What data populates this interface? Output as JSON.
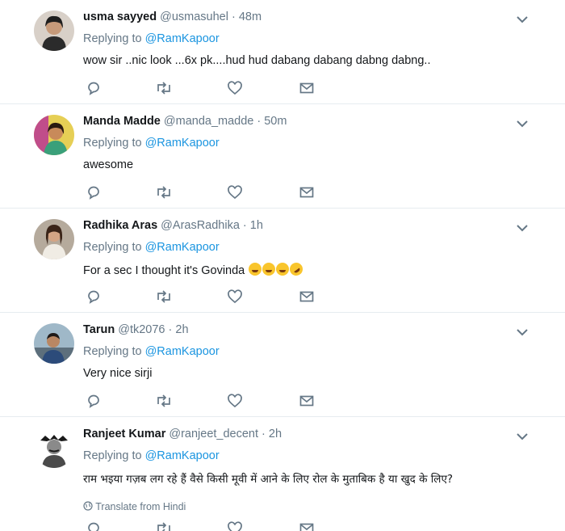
{
  "tweets": [
    {
      "name": "usma sayyed",
      "handle": "@usmasuhel · 48m",
      "replying_prefix": "Replying to ",
      "replying_to": "@RamKapoor",
      "text": "wow sir ..nic look ...6x pk....hud hud dabang dabang dabng dabng..",
      "avatar_color": "#2b2b2b"
    },
    {
      "name": "Manda Madde",
      "handle": "@manda_madde · 50m",
      "replying_prefix": "Replying to ",
      "replying_to": "@RamKapoor",
      "text": "awesome",
      "avatar_color": "#c9a63a"
    },
    {
      "name": "Radhika Aras",
      "handle": "@ArasRadhika · 1h",
      "replying_prefix": "Replying to ",
      "replying_to": "@RamKapoor",
      "text": "For a sec I thought it's Govinda",
      "emojis": [
        "face-with-tears-of-joy",
        "face-with-tears-of-joy",
        "face-with-tears-of-joy",
        "rolling-on-floor-laughing"
      ],
      "avatar_color": "#8a7a6a"
    },
    {
      "name": "Tarun",
      "handle": "@tk2076 · 2h",
      "replying_prefix": "Replying to ",
      "replying_to": "@RamKapoor",
      "text": "Very nice sirji",
      "avatar_color": "#4a6a8a"
    },
    {
      "name": "Ranjeet Kumar",
      "handle": "@ranjeet_decent · 2h",
      "replying_prefix": "Replying to ",
      "replying_to": "@RamKapoor",
      "text": "राम भइया गज़ब लग रहे हैं वैसे किसी मूवी में आने के लिए रोल के मुताबिक है या खुद के लिए?",
      "translate": "Translate from Hindi",
      "avatar_color": "#dddddd"
    }
  ],
  "icons": {
    "reply": "reply-icon",
    "retweet": "retweet-icon",
    "like": "heart-icon",
    "dm": "envelope-icon",
    "more": "chevron-down-icon",
    "globe": "globe-icon"
  },
  "colors": {
    "link": "#1b95e0",
    "muted": "#657786",
    "icon": "#657786",
    "divider": "#e6ecf0"
  }
}
